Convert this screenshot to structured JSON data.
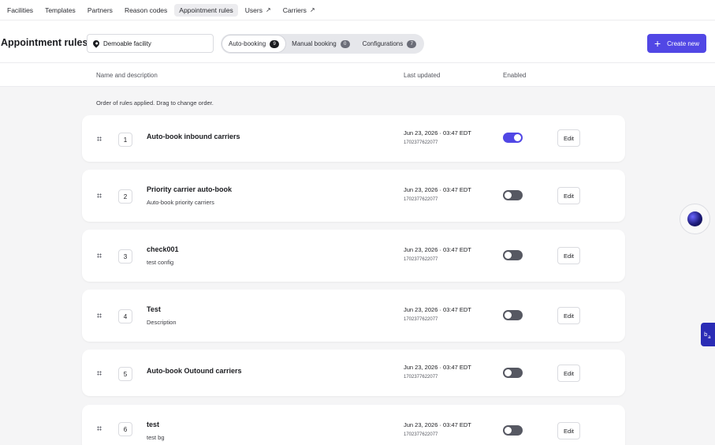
{
  "nav": {
    "items": [
      {
        "label": "Facilities",
        "active": false,
        "external": false
      },
      {
        "label": "Templates",
        "active": false,
        "external": false
      },
      {
        "label": "Partners",
        "active": false,
        "external": false
      },
      {
        "label": "Reason codes",
        "active": false,
        "external": false
      },
      {
        "label": "Appointment rules",
        "active": true,
        "external": false
      },
      {
        "label": "Users",
        "active": false,
        "external": true
      },
      {
        "label": "Carriers",
        "active": false,
        "external": true
      }
    ],
    "external_icon": "↗"
  },
  "header": {
    "title": "Appointment rules",
    "facility": "Demoable facility",
    "tabs": [
      {
        "label": "Auto-booking",
        "count": "9",
        "active": true
      },
      {
        "label": "Manual booking",
        "count": "0",
        "active": false
      },
      {
        "label": "Configurations",
        "count": "7",
        "active": false
      }
    ],
    "create_label": "Create new",
    "create_icon": "+"
  },
  "table": {
    "col_name": "Name and description",
    "col_updated": "Last updated",
    "col_enabled": "Enabled",
    "hint": "Order of rules applied. Drag to change order."
  },
  "rows": [
    {
      "index": "1",
      "name": "Auto-book inbound carriers",
      "description": "",
      "date": "Jun 23, 2026 · 03:47 EDT",
      "id": "1702377622077",
      "enabled": true,
      "edit": "Edit"
    },
    {
      "index": "2",
      "name": "Priority carrier auto-book",
      "description": "Auto-book priority carriers",
      "date": "Jun 23, 2026 · 03:47 EDT",
      "id": "1702377622077",
      "enabled": false,
      "edit": "Edit"
    },
    {
      "index": "3",
      "name": "check001",
      "description": "test config",
      "date": "Jun 23, 2026 · 03:47 EDT",
      "id": "1702377622077",
      "enabled": false,
      "edit": "Edit"
    },
    {
      "index": "4",
      "name": "Test",
      "description": "Description",
      "date": "Jun 23, 2026 · 03:47 EDT",
      "id": "1702377622077",
      "enabled": false,
      "edit": "Edit"
    },
    {
      "index": "5",
      "name": "Auto-book Outound carriers",
      "description": "",
      "date": "Jun 23, 2026 · 03:47 EDT",
      "id": "1702377622077",
      "enabled": false,
      "edit": "Edit"
    },
    {
      "index": "6",
      "name": "test",
      "description": "test bg",
      "date": "Jun 23, 2026 · 03:47 EDT",
      "id": "1702377622077",
      "enabled": false,
      "edit": "Edit"
    }
  ],
  "colors": {
    "accent": "#5147e5",
    "toggle_off": "#565862",
    "background": "#f5f5f6"
  },
  "widgets": {
    "side_tab_icon": "translate-icon",
    "orb_icon": "assistant-orb-icon"
  }
}
